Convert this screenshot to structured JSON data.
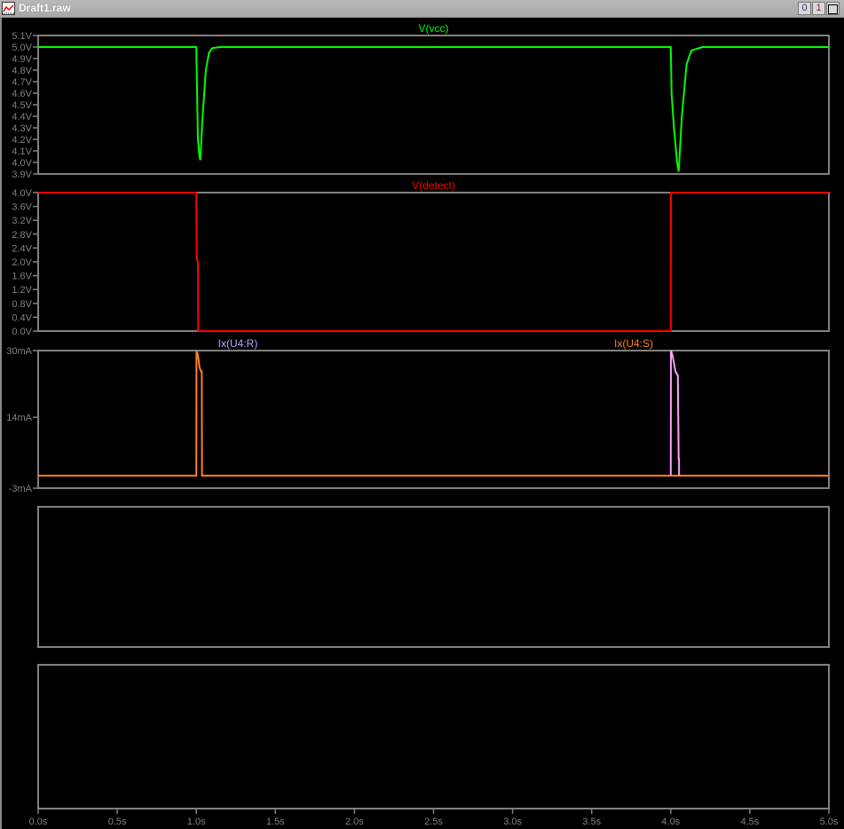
{
  "window": {
    "title": "Draft1.raw",
    "buttons": [
      "0",
      "1",
      ""
    ]
  },
  "chart_data": [
    {
      "type": "line",
      "title": "V(vcc)",
      "color": "#00ff00",
      "ylim": [
        3.9,
        5.1
      ],
      "yticks": [
        "5.1V",
        "5.0V",
        "4.9V",
        "4.8V",
        "4.7V",
        "4.6V",
        "4.5V",
        "4.4V",
        "4.3V",
        "4.2V",
        "4.1V",
        "4.0V",
        "3.9V"
      ],
      "ytick_values": [
        5.1,
        5.0,
        4.9,
        4.8,
        4.7,
        4.6,
        4.5,
        4.4,
        4.3,
        4.2,
        4.1,
        4.0,
        3.9
      ],
      "series": [
        {
          "name": "V(vcc)",
          "color": "#00ff00",
          "x": [
            0,
            1.0,
            1.005,
            1.01,
            1.02,
            1.025,
            1.04,
            1.06,
            1.08,
            1.1,
            1.15,
            4.0,
            4.005,
            4.02,
            4.04,
            4.05,
            4.07,
            4.1,
            4.13,
            4.2,
            5.0
          ],
          "y": [
            5.0,
            5.0,
            4.6,
            4.2,
            4.05,
            4.02,
            4.4,
            4.8,
            4.95,
            4.99,
            5.0,
            5.0,
            4.6,
            4.3,
            4.0,
            3.92,
            4.4,
            4.85,
            4.97,
            5.0,
            5.0
          ]
        }
      ]
    },
    {
      "type": "line",
      "title": "V(detect)",
      "color": "#ff0000",
      "ylim": [
        0,
        4.0
      ],
      "yticks": [
        "4.0V",
        "3.6V",
        "3.2V",
        "2.8V",
        "2.4V",
        "2.0V",
        "1.6V",
        "1.2V",
        "0.8V",
        "0.4V",
        "0.0V"
      ],
      "ytick_values": [
        4.0,
        3.6,
        3.2,
        2.8,
        2.4,
        2.0,
        1.6,
        1.2,
        0.8,
        0.4,
        0.0
      ],
      "series": [
        {
          "name": "V(detect)",
          "color": "#ff0000",
          "x": [
            0,
            1.0,
            1.003,
            1.01,
            1.012,
            4.0,
            4.001,
            5.0
          ],
          "y": [
            4.0,
            4.0,
            2.1,
            2.0,
            0,
            0,
            4.0,
            4.0
          ]
        }
      ]
    },
    {
      "type": "line",
      "title": "",
      "ylim": [
        -3,
        30
      ],
      "yticks": [
        "30mA",
        "14mA",
        "-3mA"
      ],
      "ytick_values": [
        30,
        14,
        -3
      ],
      "series": [
        {
          "name": "Ix(U4:R)",
          "label_color": "#b0a8ff",
          "color": "#ff7f1e",
          "x": [
            0,
            1.0,
            1.001,
            1.01,
            1.02,
            1.03,
            1.032,
            1.035,
            1.036,
            4.0,
            4.05,
            5.0
          ],
          "y": [
            0,
            0,
            30,
            29,
            26,
            25,
            25,
            25,
            0,
            0,
            0,
            0
          ]
        },
        {
          "name": "Ix(U4:S)",
          "label_color": "#ff7f1e",
          "color": "#ffa0ff",
          "x": [
            4.0,
            4.001,
            4.01,
            4.02,
            4.03,
            4.045,
            4.05,
            4.052,
            4.053
          ],
          "y": [
            0,
            30,
            29,
            27,
            25,
            24,
            4,
            4,
            0
          ]
        }
      ]
    },
    {
      "type": "line",
      "title": "",
      "series": []
    },
    {
      "type": "line",
      "title": "",
      "series": []
    }
  ],
  "xaxis": {
    "xlim": [
      0,
      5
    ],
    "ticks": [
      "0.0s",
      "0.5s",
      "1.0s",
      "1.5s",
      "2.0s",
      "2.5s",
      "3.0s",
      "3.5s",
      "4.0s",
      "4.5s",
      "5.0s"
    ],
    "tick_values": [
      0,
      0.5,
      1,
      1.5,
      2,
      2.5,
      3,
      3.5,
      4,
      4.5,
      5
    ]
  }
}
